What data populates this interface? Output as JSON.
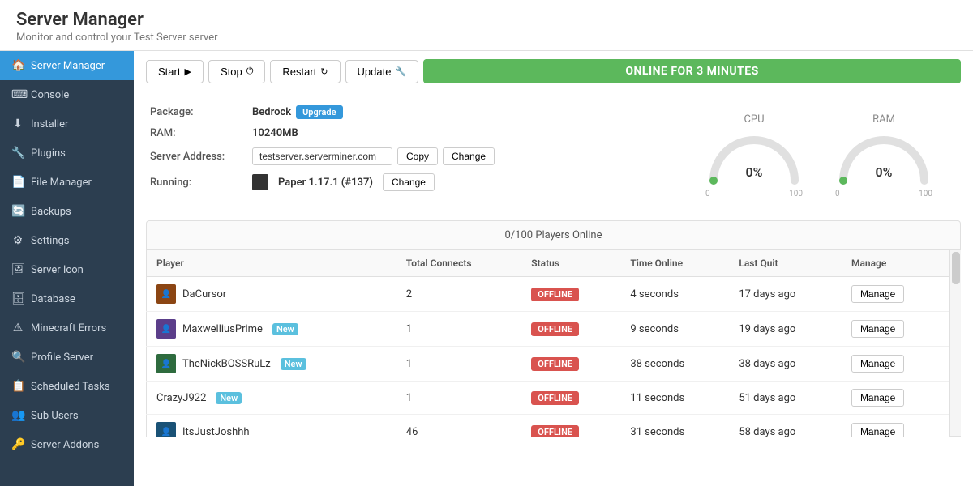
{
  "header": {
    "title": "Server Manager",
    "subtitle": "Monitor and control your Test Server server"
  },
  "sidebar": {
    "items": [
      {
        "id": "server-manager",
        "label": "Server Manager",
        "icon": "🏠",
        "active": true
      },
      {
        "id": "console",
        "label": "Console",
        "icon": "⌨"
      },
      {
        "id": "installer",
        "label": "Installer",
        "icon": "⬇"
      },
      {
        "id": "plugins",
        "label": "Plugins",
        "icon": "🔧"
      },
      {
        "id": "file-manager",
        "label": "File Manager",
        "icon": "📄"
      },
      {
        "id": "backups",
        "label": "Backups",
        "icon": "🔄"
      },
      {
        "id": "settings",
        "label": "Settings",
        "icon": "⚙"
      },
      {
        "id": "server-icon",
        "label": "Server Icon",
        "icon": "🖼"
      },
      {
        "id": "database",
        "label": "Database",
        "icon": "🗄"
      },
      {
        "id": "minecraft-errors",
        "label": "Minecraft Errors",
        "icon": "⚠"
      },
      {
        "id": "profile-server",
        "label": "Profile Server",
        "icon": "🔍"
      },
      {
        "id": "scheduled-tasks",
        "label": "Scheduled Tasks",
        "icon": "📋"
      },
      {
        "id": "sub-users",
        "label": "Sub Users",
        "icon": "👥"
      },
      {
        "id": "server-addons",
        "label": "Server Addons",
        "icon": "🔑"
      }
    ]
  },
  "toolbar": {
    "start_label": "Start",
    "stop_label": "Stop",
    "restart_label": "Restart",
    "update_label": "Update",
    "status_text": "ONLINE FOR 3 MINUTES"
  },
  "server_info": {
    "package_label": "Package:",
    "package_value": "Bedrock",
    "upgrade_label": "Upgrade",
    "ram_label": "RAM:",
    "ram_value": "10240MB",
    "address_label": "Server Address:",
    "address_value": "testserver.serverminer.com",
    "copy_label": "Copy",
    "change_label": "Change",
    "change_label2": "Change",
    "running_label": "Running:",
    "running_value": "Paper 1.17.1 (#137)"
  },
  "gauges": {
    "cpu_label": "CPU",
    "cpu_value": "0%",
    "cpu_min": "0",
    "cpu_max": "100",
    "ram_label": "RAM",
    "ram_value": "0%",
    "ram_min": "0",
    "ram_max": "100"
  },
  "players": {
    "header": "0/100 Players Online",
    "columns": [
      "Player",
      "Total Connects",
      "Status",
      "Time Online",
      "Last Quit",
      "Manage"
    ],
    "rows": [
      {
        "name": "DaCursor",
        "connects": "2",
        "status": "OFFLINE",
        "time_online": "4 seconds",
        "last_quit": "17 days ago",
        "has_avatar": true
      },
      {
        "name": "MaxwelliusPrime",
        "badge": "New",
        "connects": "1",
        "status": "OFFLINE",
        "time_online": "9 seconds",
        "last_quit": "19 days ago",
        "has_avatar": true
      },
      {
        "name": "TheNickBOSSRuLz",
        "badge": "New",
        "connects": "1",
        "status": "OFFLINE",
        "time_online": "38 seconds",
        "last_quit": "38 days ago",
        "has_avatar": true
      },
      {
        "name": "CrazyJ922",
        "badge": "New",
        "connects": "1",
        "status": "OFFLINE",
        "time_online": "11 seconds",
        "last_quit": "51 days ago",
        "has_avatar": false
      },
      {
        "name": "ItsJustJoshhh",
        "connects": "46",
        "status": "OFFLINE",
        "time_online": "31 seconds",
        "last_quit": "58 days ago",
        "has_avatar": true
      }
    ],
    "manage_label": "Manage"
  },
  "colors": {
    "accent_blue": "#3498db",
    "sidebar_bg": "#2c3e50",
    "online_green": "#5cb85c",
    "offline_red": "#d9534f",
    "active_blue": "#3498db"
  }
}
